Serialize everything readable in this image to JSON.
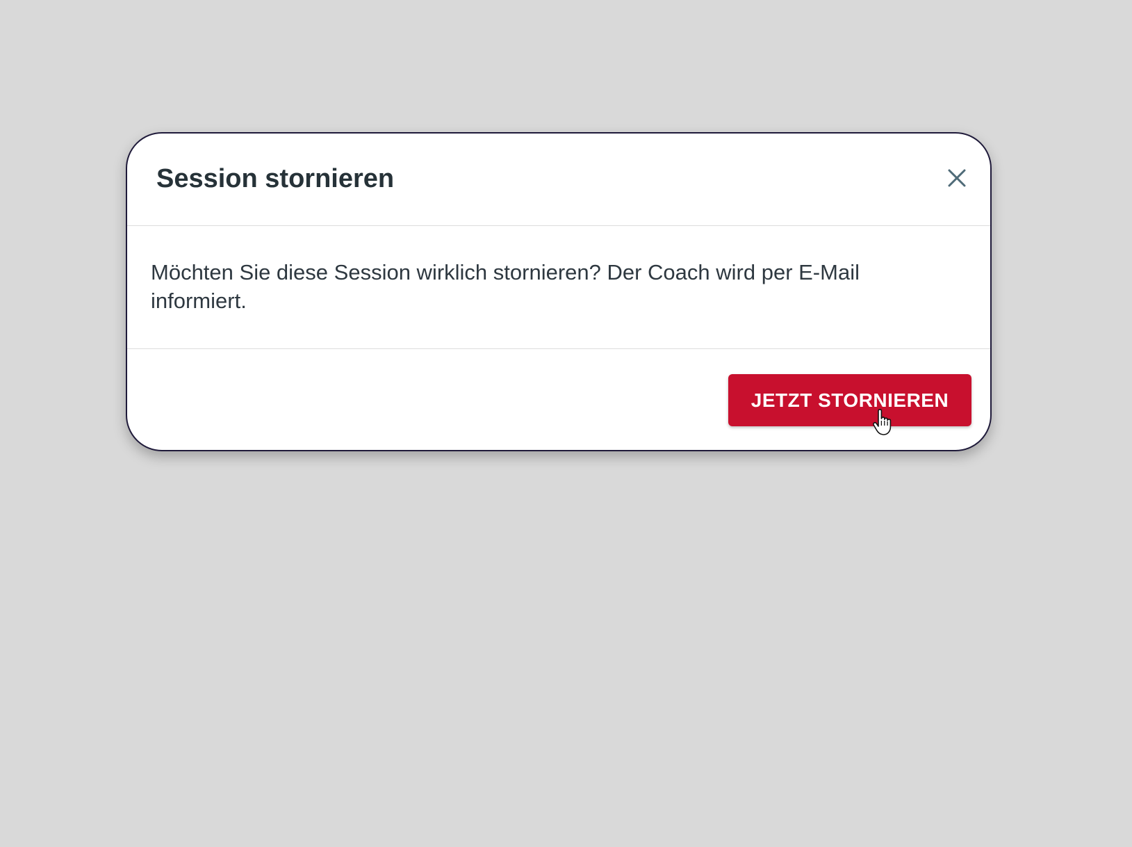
{
  "dialog": {
    "title": "Session stornieren",
    "message": "Möchten Sie diese Session wirklich stornieren? Der Coach wird per E-Mail informiert.",
    "confirm_label": "JETZT STORNIEREN",
    "close_icon": "close-icon"
  },
  "colors": {
    "background": "#d9d9d9",
    "dialog_border": "#1f1a3a",
    "title": "#263238",
    "confirm_button": "#c8102e",
    "close_icon": "#4f6b78"
  }
}
